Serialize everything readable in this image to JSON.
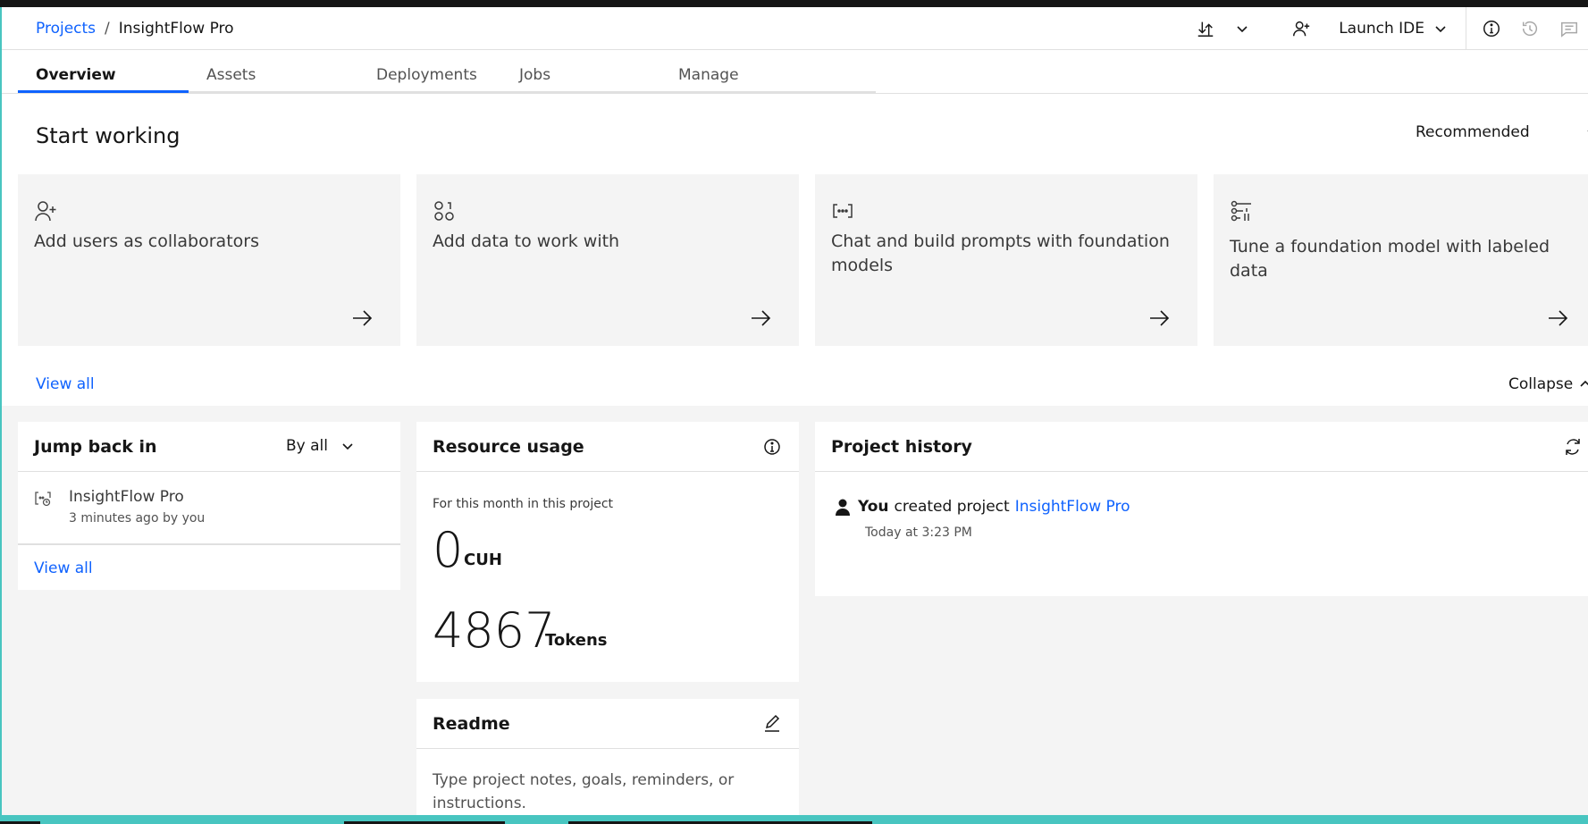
{
  "header": {
    "breadcrumb_root": "Projects",
    "breadcrumb_sep": "/",
    "project_name": "InsightFlow Pro",
    "launch_ide": "Launch IDE"
  },
  "tabs": [
    {
      "label": "Overview",
      "active": true
    },
    {
      "label": "Assets"
    },
    {
      "label": "Deployments"
    },
    {
      "label": "Jobs"
    },
    {
      "label": "Manage"
    }
  ],
  "start_working": {
    "title": "Start working",
    "filter": "Recommended",
    "cards": [
      {
        "text": "Add users as collaborators",
        "icon": "add-user-icon"
      },
      {
        "text": "Add data to work with",
        "icon": "data-icon"
      },
      {
        "text": "Chat and build prompts with foundation models",
        "icon": "prompt-icon"
      },
      {
        "text": "Tune a foundation model with labeled data",
        "icon": "tune-icon"
      }
    ],
    "view_all": "View all",
    "collapse": "Collapse"
  },
  "jump_back": {
    "title": "Jump back in",
    "filter": "By all",
    "item_name": "InsightFlow Pro",
    "item_meta": "3 minutes ago by you",
    "view_all": "View all"
  },
  "resource_usage": {
    "title": "Resource usage",
    "subtitle": "For this month in this project",
    "cuh_value": "0",
    "cuh_unit": "CUH",
    "tokens_value": "4867",
    "tokens_unit": "Tokens"
  },
  "readme": {
    "title": "Readme",
    "placeholder": "Type project notes, goals, reminders, or instructions."
  },
  "project_history": {
    "title": "Project history",
    "actor": "You",
    "action": "created project",
    "target": "InsightFlow Pro",
    "time": "Today at 3:23 PM"
  },
  "colors": {
    "link": "#0f62fe",
    "tile_bg": "#f4f4f4",
    "accent_border": "#48c5c0"
  }
}
